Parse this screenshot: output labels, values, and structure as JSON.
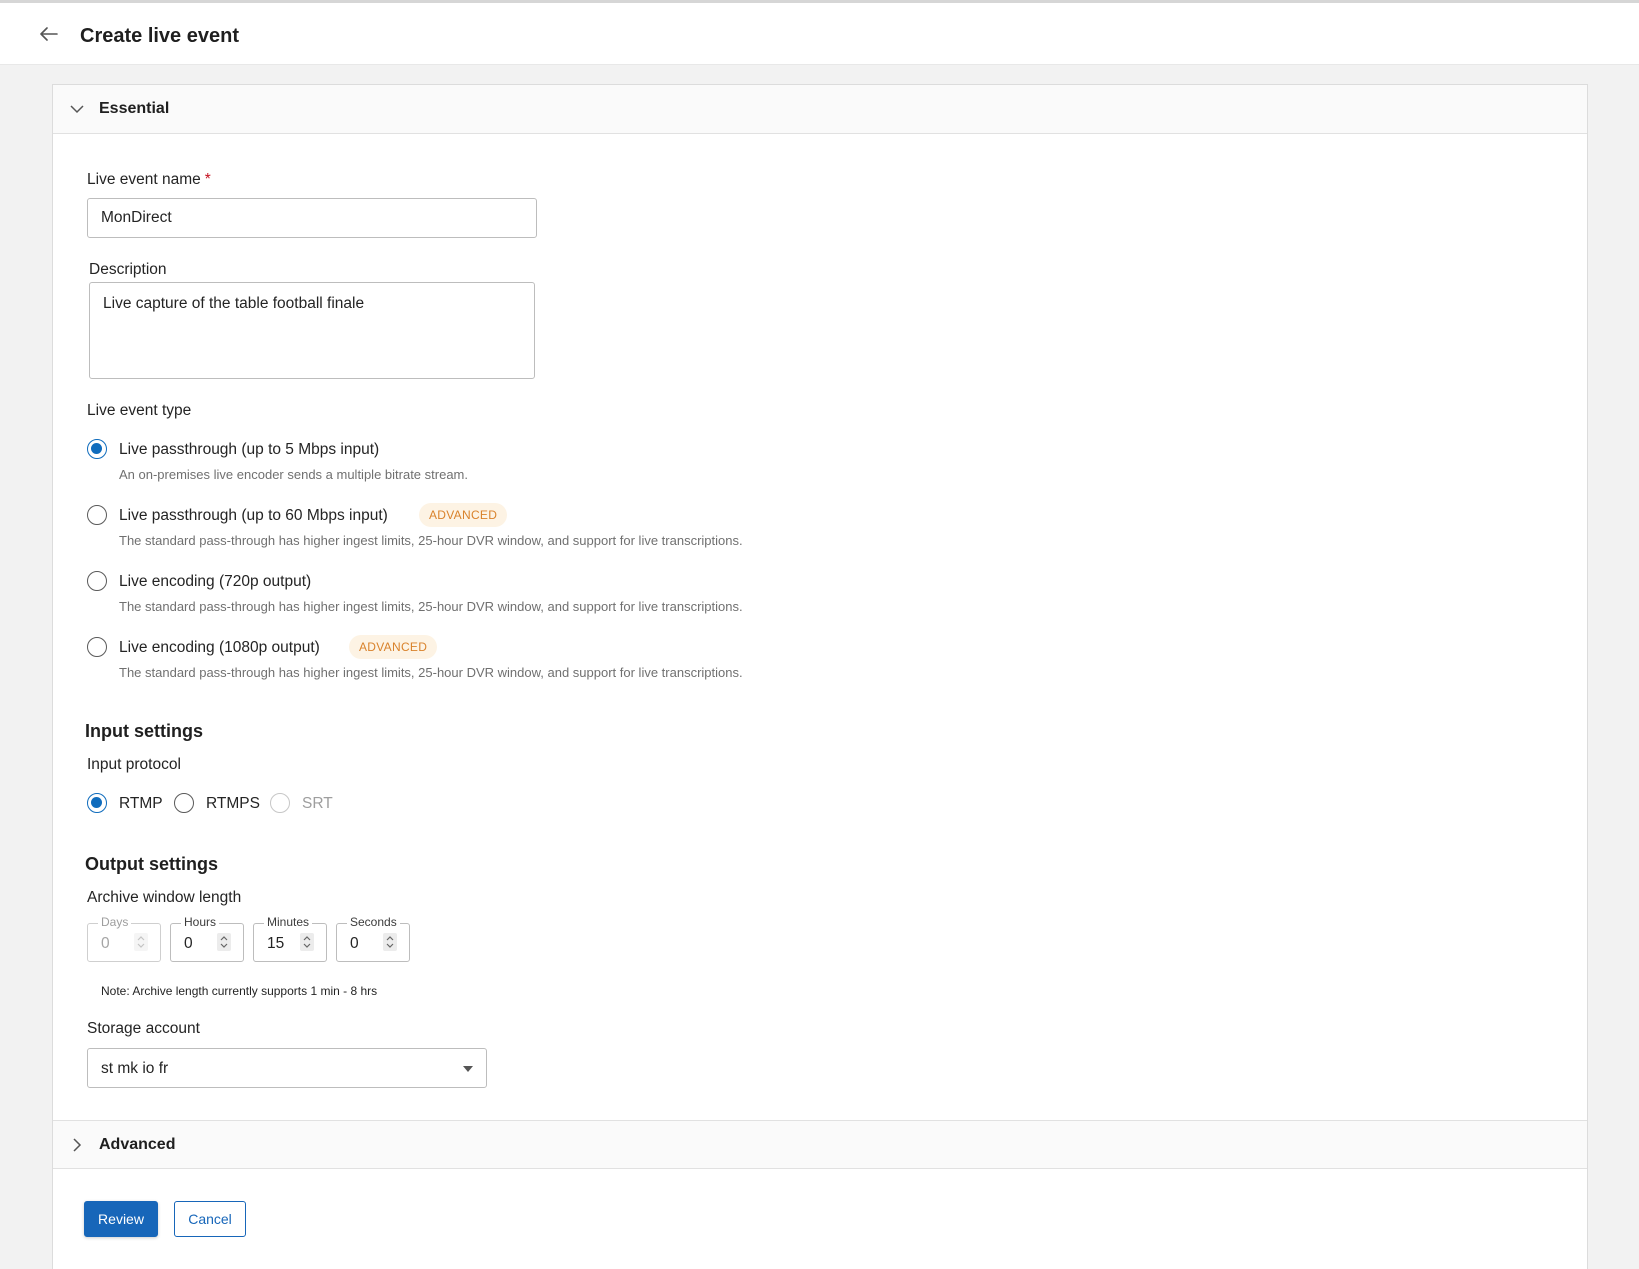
{
  "header": {
    "title": "Create live event",
    "back_icon": "arrow-left-icon"
  },
  "sections": {
    "essential": "Essential",
    "advanced": "Advanced"
  },
  "form": {
    "name_label": "Live event name",
    "name_required_mark": "*",
    "name_value": "MonDirect",
    "description_label": "Description",
    "description_value": "Live capture of the table football finale",
    "type_label": "Live event type",
    "type_options": [
      {
        "label": "Live passthrough (up to 5 Mbps input)",
        "desc": "An on-premises live encoder sends a multiple bitrate stream.",
        "badge": "",
        "selected": true
      },
      {
        "label": "Live passthrough (up to 60 Mbps input)",
        "desc": "The standard pass-through has higher ingest limits, 25-hour DVR window, and support for live transcriptions.",
        "badge": "ADVANCED",
        "selected": false
      },
      {
        "label": "Live encoding (720p output)",
        "desc": "The standard pass-through has higher ingest limits, 25-hour DVR window, and support for live transcriptions.",
        "badge": "",
        "selected": false
      },
      {
        "label": "Live encoding (1080p output)",
        "desc": "The standard pass-through has higher ingest limits, 25-hour DVR window, and support for live transcriptions.",
        "badge": "ADVANCED",
        "selected": false
      }
    ]
  },
  "input_settings": {
    "heading": "Input settings",
    "protocol_label": "Input protocol",
    "protocols": [
      {
        "label": "RTMP",
        "selected": true,
        "disabled": false
      },
      {
        "label": "RTMPS",
        "selected": false,
        "disabled": false
      },
      {
        "label": "SRT",
        "selected": false,
        "disabled": true
      }
    ]
  },
  "output_settings": {
    "heading": "Output settings",
    "archive_label": "Archive window length",
    "archive_fields": [
      {
        "legend": "Days",
        "value": "0",
        "disabled": true
      },
      {
        "legend": "Hours",
        "value": "0",
        "disabled": false
      },
      {
        "legend": "Minutes",
        "value": "15",
        "disabled": false
      },
      {
        "legend": "Seconds",
        "value": "0",
        "disabled": false
      }
    ],
    "note": "Note: Archive length currently supports 1 min - 8 hrs",
    "storage_label": "Storage account",
    "storage_value": "st mk io fr"
  },
  "footer": {
    "review": "Review",
    "cancel": "Cancel"
  },
  "colors": {
    "accent": "#0f6cbd",
    "badge_bg": "#fdf3e4",
    "badge_text": "#d9822b",
    "required": "#c50f1f"
  }
}
